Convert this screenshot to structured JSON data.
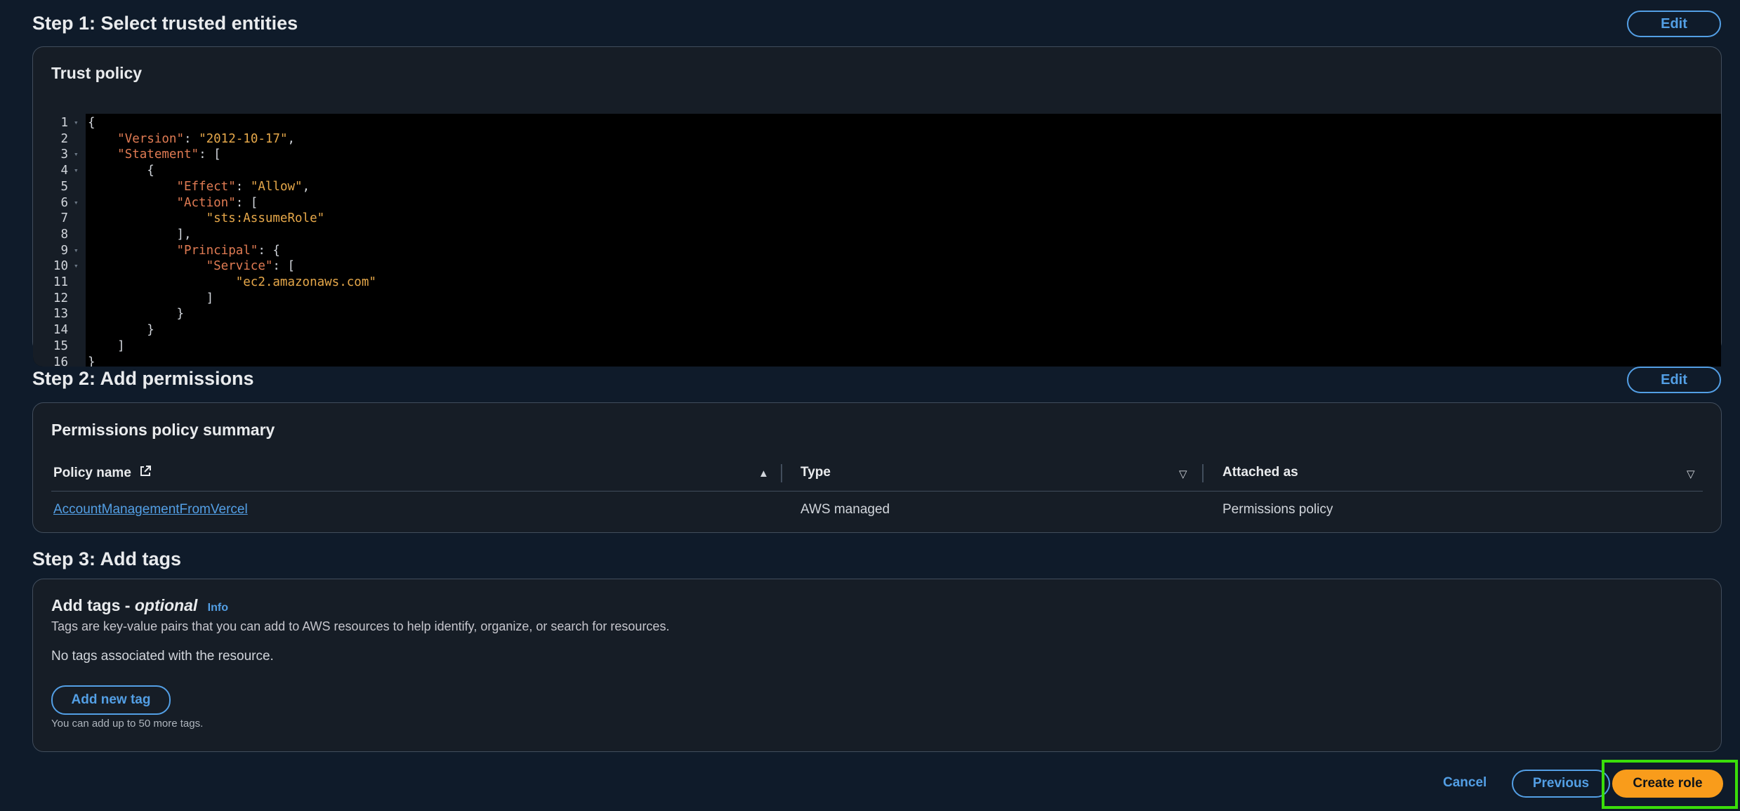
{
  "step1": {
    "title": "Step 1: Select trusted entities",
    "edit_label": "Edit",
    "panel_title": "Trust policy",
    "code_lines": [
      {
        "n": "1",
        "fold": true
      },
      {
        "n": "2",
        "fold": false
      },
      {
        "n": "3",
        "fold": true
      },
      {
        "n": "4",
        "fold": true
      },
      {
        "n": "5",
        "fold": false
      },
      {
        "n": "6",
        "fold": true
      },
      {
        "n": "7",
        "fold": false
      },
      {
        "n": "8",
        "fold": false
      },
      {
        "n": "9",
        "fold": true
      },
      {
        "n": "10",
        "fold": true
      },
      {
        "n": "11",
        "fold": false
      },
      {
        "n": "12",
        "fold": false
      },
      {
        "n": "13",
        "fold": false
      },
      {
        "n": "14",
        "fold": false
      },
      {
        "n": "15",
        "fold": false
      },
      {
        "n": "16",
        "fold": false
      }
    ],
    "code": {
      "l1": "{",
      "version_key": "\"Version\"",
      "version_val": "\"2012-10-17\"",
      "statement_key": "\"Statement\"",
      "l3_tail": ": [",
      "l4": "{",
      "effect_key": "\"Effect\"",
      "effect_val": "\"Allow\"",
      "action_key": "\"Action\"",
      "l6_tail": ": [",
      "action_val": "\"sts:AssumeRole\"",
      "l8": "],",
      "principal_key": "\"Principal\"",
      "l9_tail": ": {",
      "service_key": "\"Service\"",
      "l10_tail": ": [",
      "service_val": "\"ec2.amazonaws.com\"",
      "l12": "]",
      "l13": "}",
      "l14": "}",
      "l15": "]",
      "l16": "}"
    }
  },
  "step2": {
    "title": "Step 2: Add permissions",
    "edit_label": "Edit",
    "panel_title": "Permissions policy summary",
    "columns": [
      "Policy name",
      "Type",
      "Attached as"
    ],
    "rows": [
      {
        "policy_name": "AccountManagementFromVercel",
        "type": "AWS managed",
        "attached_as": "Permissions policy"
      }
    ]
  },
  "step3": {
    "title": "Step 3: Add tags",
    "panel_title": "Add tags - ",
    "panel_title_optional": "optional",
    "info_label": "Info",
    "description": "Tags are key-value pairs that you can add to AWS resources to help identify, organize, or search for resources.",
    "empty_text": "No tags associated with the resource.",
    "add_tag_label": "Add new tag",
    "limit_text": "You can add up to 50 more tags."
  },
  "footer": {
    "cancel_label": "Cancel",
    "previous_label": "Previous",
    "create_label": "Create role"
  },
  "colors": {
    "background": "#0f1b2a",
    "accent": "#539fe5",
    "primary_button": "#f99c1b",
    "highlight": "#3ade0a"
  }
}
